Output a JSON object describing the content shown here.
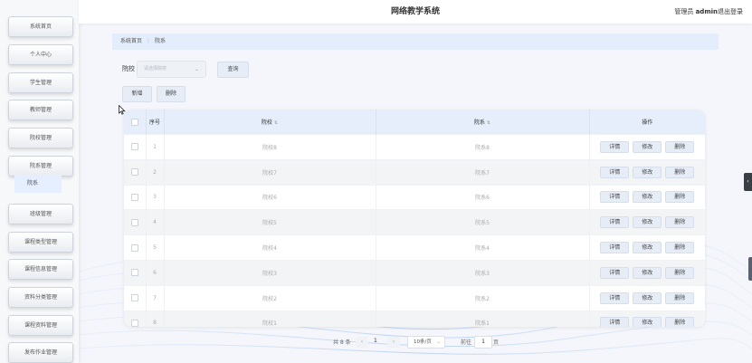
{
  "header": {
    "title": "网络教学系统",
    "user_role": "管理员",
    "user_name": "admin",
    "logout_label": "退出登录"
  },
  "sidebar": {
    "items": [
      {
        "label": "系统首页"
      },
      {
        "label": "个人中心"
      },
      {
        "label": "学生管理"
      },
      {
        "label": "教师管理"
      },
      {
        "label": "院校管理"
      },
      {
        "label": "院系管理"
      },
      {
        "label": "班级管理"
      },
      {
        "label": "课程类型管理"
      },
      {
        "label": "课程信息管理"
      },
      {
        "label": "资料分类管理"
      },
      {
        "label": "课程资料管理"
      },
      {
        "label": "发布作业管理"
      }
    ],
    "active_sub_item": "院系"
  },
  "breadcrumb": {
    "home": "系统首页",
    "current": "院系"
  },
  "search": {
    "label": "院校",
    "select_placeholder": "请选择院校",
    "query_button": "查询"
  },
  "toolbar": {
    "add_label": "新增",
    "delete_label": "删除"
  },
  "table": {
    "columns": {
      "index": "序号",
      "school": "院校",
      "department": "院系",
      "actions": "操作"
    },
    "action_labels": {
      "detail": "详情",
      "edit": "修改",
      "delete": "删除"
    },
    "rows": [
      {
        "index": "1",
        "school": "院校8",
        "department": "院系8"
      },
      {
        "index": "2",
        "school": "院校7",
        "department": "院系7"
      },
      {
        "index": "3",
        "school": "院校6",
        "department": "院系6"
      },
      {
        "index": "4",
        "school": "院校5",
        "department": "院系5"
      },
      {
        "index": "5",
        "school": "院校4",
        "department": "院系4"
      },
      {
        "index": "6",
        "school": "院校3",
        "department": "院系3"
      },
      {
        "index": "7",
        "school": "院校2",
        "department": "院系2"
      },
      {
        "index": "8",
        "school": "院校1",
        "department": "院系1"
      }
    ]
  },
  "pagination": {
    "total_text": "共 8 条",
    "current_page": "1",
    "page_size": "10条/页",
    "goto_label": "前往",
    "goto_value": "1",
    "page_unit": "页"
  }
}
